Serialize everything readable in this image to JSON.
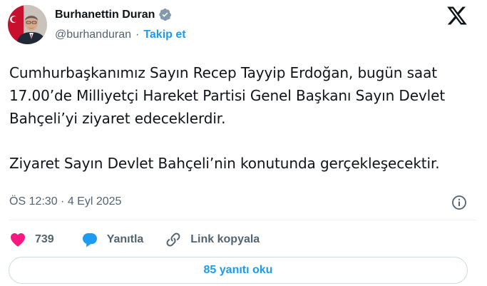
{
  "author": {
    "display_name": "Burhanettin Duran",
    "handle": "@burhanduran",
    "separator": "·",
    "follow_label": "Takip et"
  },
  "tweet": {
    "paragraph_1": "Cumhurbaşkanımız Sayın Recep Tayyip Erdoğan, bugün saat 17.00’de Milliyetçi Hareket Partisi Genel Başkanı Sayın Devlet Bahçeli’yi ziyaret edeceklerdir.",
    "paragraph_2": "Ziyaret Sayın Devlet Bahçeli’nin konutunda gerçekleşecektir.",
    "timestamp": "ÖS 12:30 · 4 Eyl 2025"
  },
  "actions": {
    "like_count": "739",
    "reply_label": "Yanıtla",
    "copy_link_label": "Link kopyala"
  },
  "footer": {
    "read_replies_label": "85 yanıtı oku"
  },
  "colors": {
    "accent": "#1d9bf0",
    "like": "#f91880",
    "secondary_text": "#536471",
    "primary_text": "#0f1419",
    "verified_badge": "#829aab"
  },
  "icons": [
    "verified-badge-icon",
    "x-logo-icon",
    "info-icon",
    "heart-icon",
    "speech-bubble-icon",
    "link-icon"
  ]
}
